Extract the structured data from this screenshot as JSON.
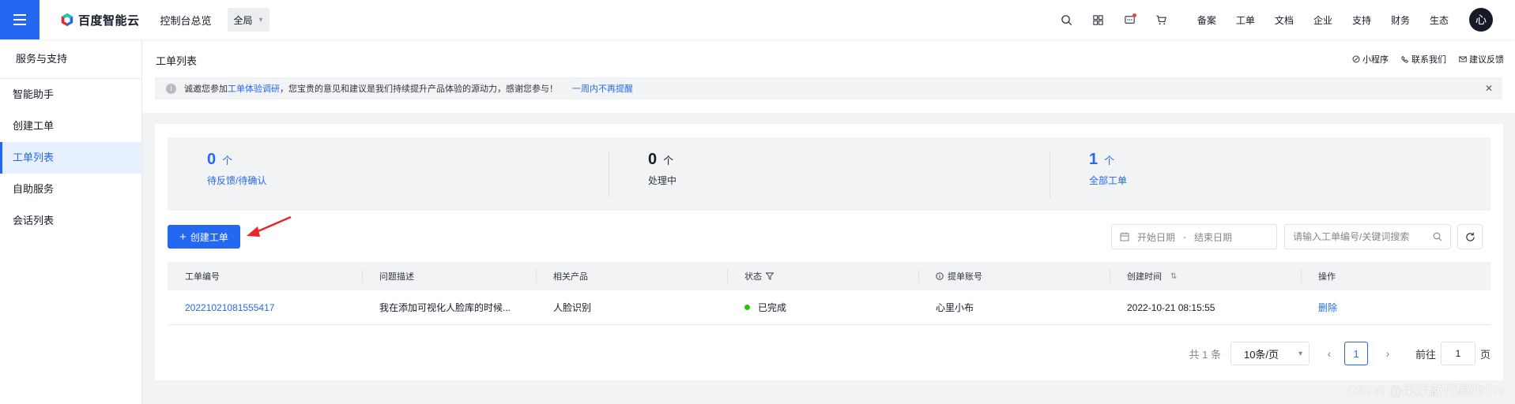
{
  "topbar": {
    "brand": "百度智能云",
    "console_link": "控制台总览",
    "region": "全局",
    "links": [
      "备案",
      "工单",
      "文档",
      "企业",
      "支持",
      "财务",
      "生态"
    ],
    "avatar_text": "心"
  },
  "sidebar": {
    "title": "服务与支持",
    "items": [
      {
        "label": "智能助手"
      },
      {
        "label": "创建工单"
      },
      {
        "label": "工单列表"
      },
      {
        "label": "自助服务"
      },
      {
        "label": "会话列表"
      }
    ],
    "active_index": 2
  },
  "header": {
    "title": "工单列表",
    "links": {
      "mini_program": "小程序",
      "contact_us": "联系我们",
      "feedback": "建议反馈"
    }
  },
  "notice": {
    "prefix": "诚邀您参加",
    "link": "工单体验调研",
    "text": "，您宝贵的意见和建议是我们持续提升产品体验的源动力，感谢您参与！",
    "dismiss": "一周内不再提醒"
  },
  "stats": [
    {
      "value": "0",
      "unit": "个",
      "label": "待反馈/待确认"
    },
    {
      "value": "0",
      "unit": "个",
      "label": "处理中"
    },
    {
      "value": "1",
      "unit": "个",
      "label": "全部工单"
    }
  ],
  "toolbar": {
    "create_label": "创建工单",
    "start_date_placeholder": "开始日期",
    "date_separator": "-",
    "end_date_placeholder": "结束日期",
    "search_placeholder": "请输入工单编号/关键词搜索"
  },
  "table": {
    "columns": [
      "工单编号",
      "问题描述",
      "相关产品",
      "状态",
      "提单账号",
      "创建时间",
      "操作"
    ],
    "rows": [
      {
        "id": "20221021081555417",
        "description": "我在添加可视化人脸库的时候...",
        "product": "人脸识别",
        "status": "已完成",
        "account": "心里小布",
        "created": "2022-10-21 08:15:55",
        "action": "删除"
      }
    ]
  },
  "pagination": {
    "total": "共 1 条",
    "page_size": "10条/页",
    "current_page": "1",
    "goto_prefix": "前往",
    "goto_value": "1",
    "goto_suffix": "页"
  },
  "watermark": "CSDN @呆呆敲代码的小Y",
  "colors": {
    "accent": "#2468f2",
    "status_done": "#30bf13",
    "arrow": "#e8262a"
  }
}
